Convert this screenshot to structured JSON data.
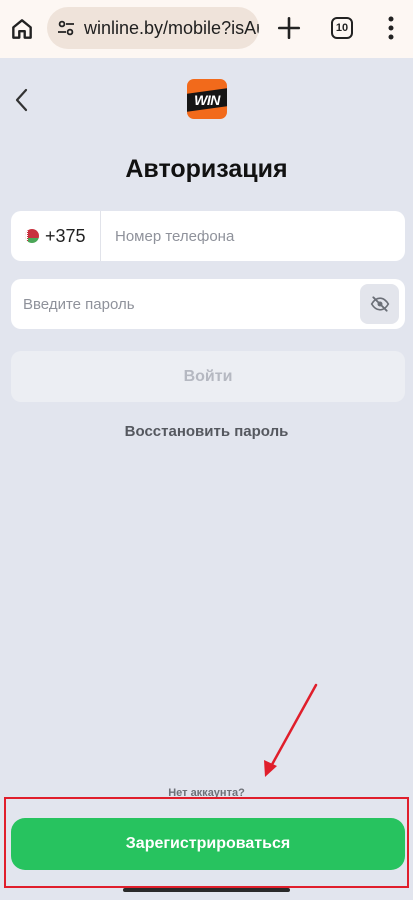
{
  "browser": {
    "url": "winline.by/mobile?isAu",
    "tab_count": "10",
    "icons": [
      "home-icon",
      "tune-icon",
      "plus-icon",
      "tabs-icon",
      "more-vert-icon"
    ]
  },
  "page": {
    "logo_text": "WIN",
    "title": "Авторизация",
    "phone": {
      "country_code": "+375",
      "placeholder": "Номер телефона",
      "value": ""
    },
    "password": {
      "placeholder": "Введите пароль",
      "value": ""
    },
    "login_label": "Войти",
    "restore_label": "Восстановить пароль",
    "no_account_text": "Нет аккаунта?",
    "register_label": "Зарегистрироваться"
  },
  "colors": {
    "background": "#e2e5ee",
    "brand_orange": "#f26a1b",
    "register_green": "#27c35f",
    "annotation_red": "#e01e2b"
  }
}
